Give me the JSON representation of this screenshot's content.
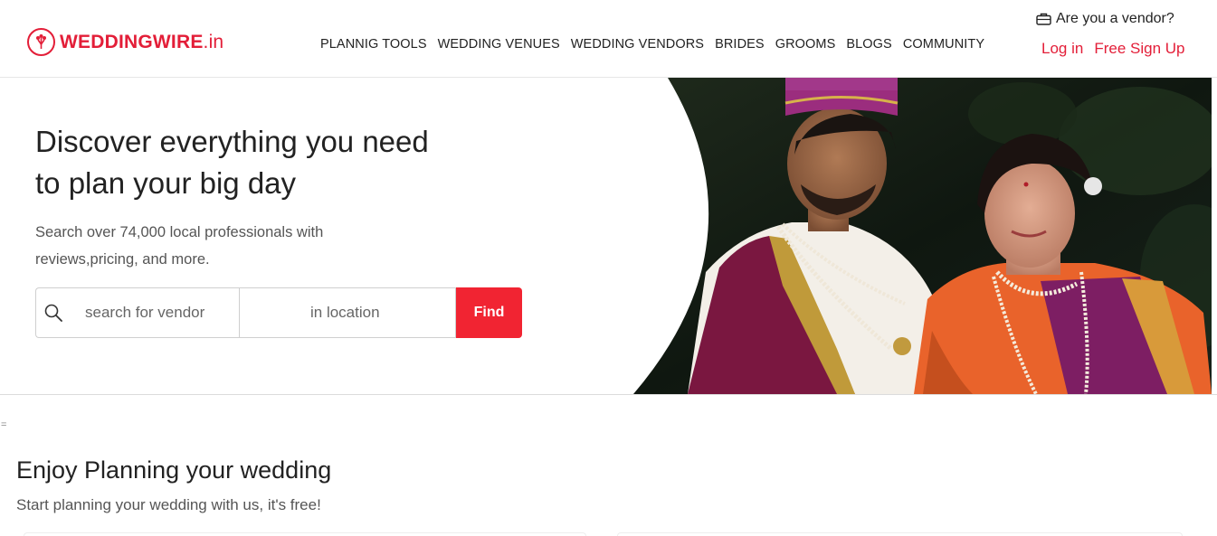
{
  "brand": {
    "name": "WEDDINGWIRE",
    "suffix": ".in",
    "color": "#e31e38"
  },
  "nav": {
    "items": [
      {
        "label": "PLANNIG TOOLS"
      },
      {
        "label": "WEDDING VENUES"
      },
      {
        "label": "WEDDING VENDORS"
      },
      {
        "label": "BRIDES"
      },
      {
        "label": "GROOMS"
      },
      {
        "label": "BLOGS"
      },
      {
        "label": "COMMUNITY"
      }
    ]
  },
  "vendor": {
    "label": "Are you a vendor?",
    "icon": "briefcase-icon"
  },
  "auth": {
    "login": "Log in",
    "signup": "Free Sign Up"
  },
  "hero": {
    "title_line1": "Discover everything you need",
    "title_line2": "to plan your big day",
    "sub_line1": "Search over 74,000 local professionals with",
    "sub_line2": "reviews,pricing, and more."
  },
  "search": {
    "vendor_placeholder": "search for vendor",
    "location_placeholder": "in location",
    "find_label": "Find",
    "find_color": "#f12432"
  },
  "misc": {
    "mark": "="
  },
  "planning": {
    "title": "Enjoy Planning your wedding",
    "subtitle": "Start planning your wedding with us, it's free!"
  }
}
